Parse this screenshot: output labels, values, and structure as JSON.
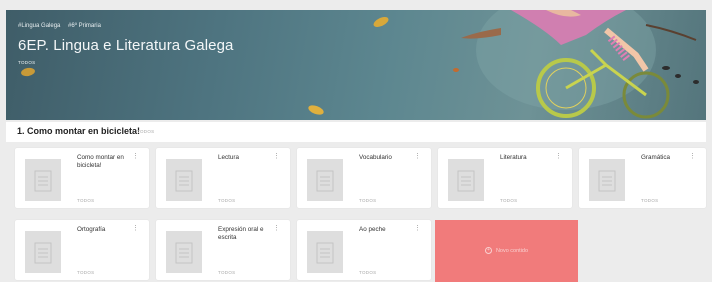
{
  "banner": {
    "tags": [
      "#Lingua Galega",
      "#6º Primaria"
    ],
    "title": "6EP. Lingua e Literatura Galega",
    "subtitle": "TODOS"
  },
  "section": {
    "title": "1. Como montar en bicicleta!",
    "tag": "TODOS"
  },
  "cards": [
    {
      "label": "Como montar en bicicleta!",
      "audience": "TODOS"
    },
    {
      "label": "Lectura",
      "audience": "TODOS"
    },
    {
      "label": "Vocabulario",
      "audience": "TODOS"
    },
    {
      "label": "Literatura",
      "audience": "TODOS"
    },
    {
      "label": "Gramática",
      "audience": "TODOS"
    },
    {
      "label": "Ortografía",
      "audience": "TODOS"
    },
    {
      "label": "Expresión oral e escrita",
      "audience": "TODOS"
    },
    {
      "label": "Ao peche",
      "audience": "TODOS"
    }
  ],
  "new_content": {
    "label": "Novo contido"
  },
  "icons": {
    "card_menu": "more-vert-icon",
    "thumb": "document-icon",
    "add": "plus-circle-icon"
  },
  "colors": {
    "new_content_bg": "#f17b7b",
    "banner_bg": "#4e7480"
  }
}
